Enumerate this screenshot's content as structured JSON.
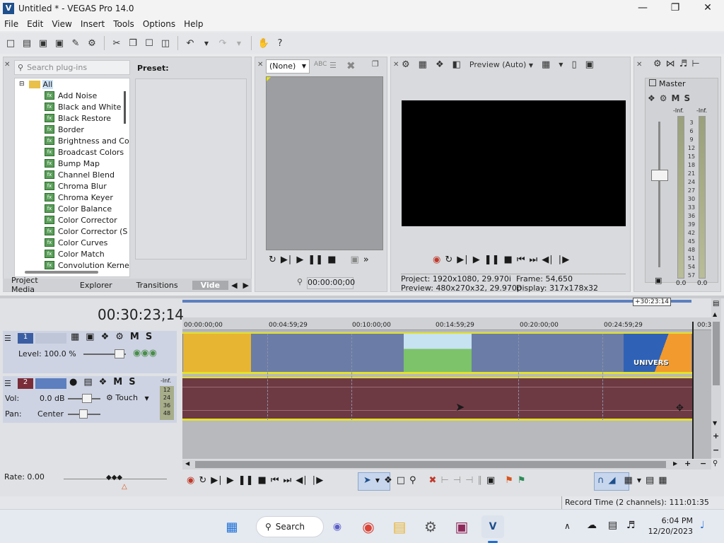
{
  "window": {
    "title": "Untitled * - VEGAS Pro 14.0",
    "app_icon": "V"
  },
  "menu": [
    "File",
    "Edit",
    "View",
    "Insert",
    "Tools",
    "Options",
    "Help"
  ],
  "plugins": {
    "search_placeholder": "Search plug-ins",
    "preset_label": "Preset:",
    "root": "All",
    "items": [
      "Add Noise",
      "Black and White",
      "Black Restore",
      "Border",
      "Brightness and Co",
      "Broadcast Colors",
      "Bump Map",
      "Channel Blend",
      "Chroma Blur",
      "Chroma Keyer",
      "Color Balance",
      "Color Corrector",
      "Color Corrector (S",
      "Color Curves",
      "Color Match",
      "Convolution Kerne"
    ],
    "fx_icon_text": "fx",
    "tabs": [
      "Project Media",
      "Explorer",
      "Transitions",
      "Vide"
    ]
  },
  "trimmer": {
    "source": "(None)",
    "timecode": "00:00:00;00"
  },
  "preview": {
    "quality": "Preview (Auto)",
    "project_label": "Project:",
    "project_value": "1920x1080, 29.970i",
    "preview_label": "Preview:",
    "preview_value": "480x270x32, 29.970p",
    "frame_label": "Frame:",
    "frame_value": "54,650",
    "display_label": "Display:",
    "display_value": "317x178x32"
  },
  "master": {
    "label": "Master",
    "inf_left": "-Inf.",
    "inf_right": "-Inf.",
    "scale": [
      "3",
      "6",
      "9",
      "12",
      "15",
      "18",
      "21",
      "24",
      "27",
      "30",
      "33",
      "36",
      "39",
      "42",
      "45",
      "48",
      "51",
      "54",
      "57"
    ],
    "bottom_left": "0.0",
    "bottom_right": "0.0"
  },
  "timeline": {
    "timecode": "00:30:23;14",
    "end_marker": "+30:23:14",
    "ruler": [
      "00:00:00;00",
      "00:04:59;29",
      "00:10:00;00",
      "00:14:59;29",
      "00:20:00;00",
      "00:24:59;29",
      "00:30:"
    ],
    "video_track": {
      "number": "1",
      "level": "Level: 100.0 %"
    },
    "audio_track": {
      "number": "2",
      "vol_label": "Vol:",
      "vol_value": "0.0 dB",
      "pan_label": "Pan:",
      "pan_value": "Center",
      "touch": "Touch",
      "inf": "-Inf.",
      "meter": [
        "12",
        "24",
        "36",
        "48"
      ]
    },
    "rate": "Rate: 0.00",
    "universe_text": "UNIVERS"
  },
  "status": {
    "record_time": "Record Time (2 channels): 111:01:35"
  },
  "track_icon_letters": {
    "mute": "M",
    "solo": "S"
  },
  "taskbar": {
    "search": "Search",
    "time": "6:04 PM",
    "date": "12/20/2023"
  },
  "colors": {
    "video_lane": "#6b7da6",
    "audio_lane": "#6d3a44",
    "yellow_clip": "#e8b533",
    "accent": "#1d6fd8"
  }
}
